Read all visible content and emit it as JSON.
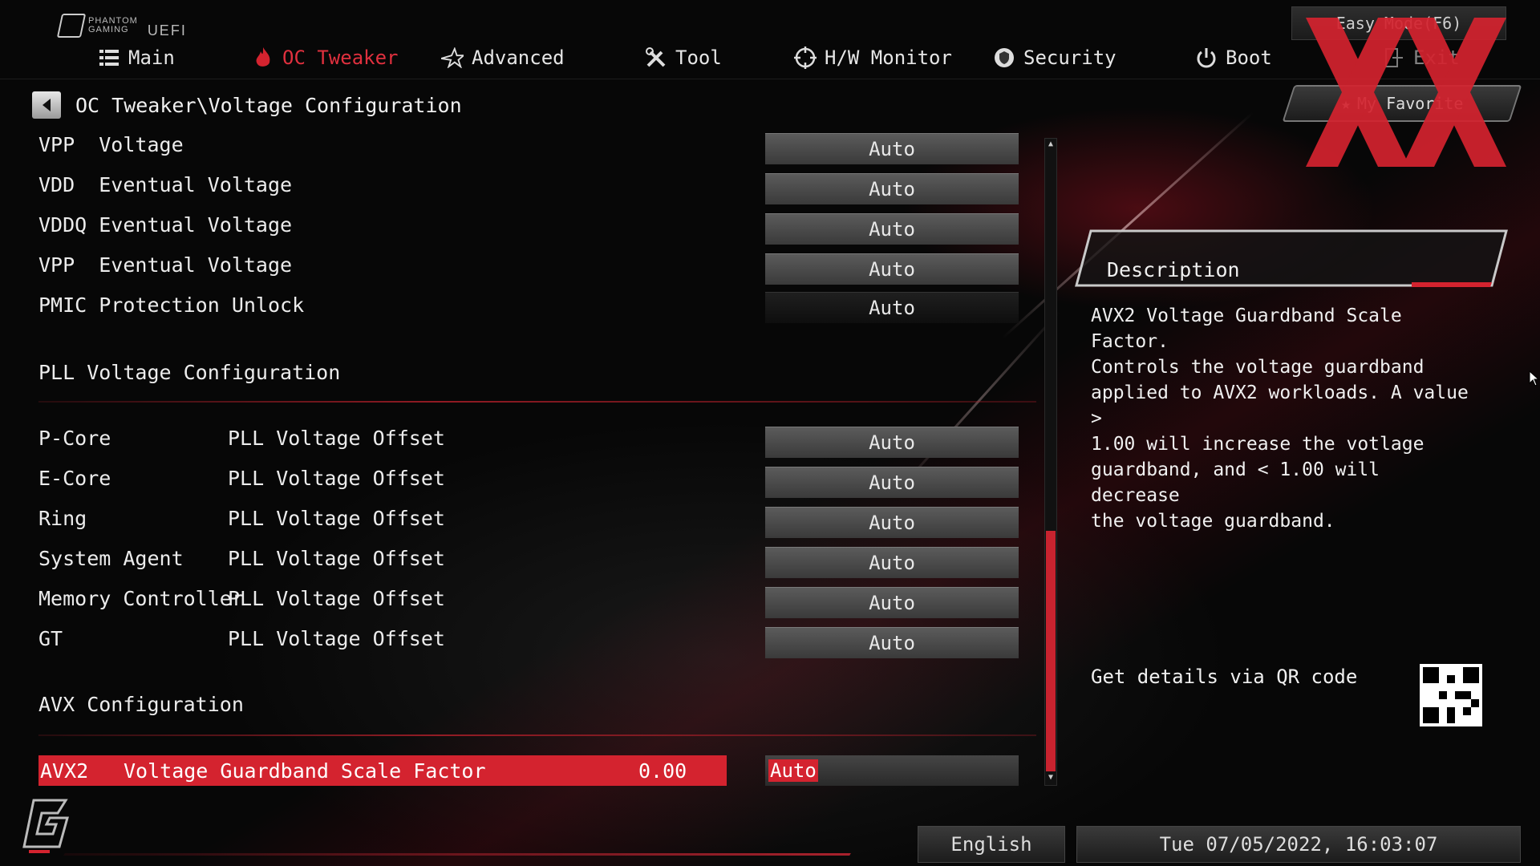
{
  "brand": {
    "line1": "PHANTOM",
    "line2": "GAMING",
    "uefi": "UEFI"
  },
  "nav": {
    "tabs": [
      {
        "label": "Main",
        "icon": "list-icon"
      },
      {
        "label": "OC Tweaker",
        "icon": "flame-icon"
      },
      {
        "label": "Advanced",
        "icon": "star-icon"
      },
      {
        "label": "Tool",
        "icon": "tools-icon"
      },
      {
        "label": "H/W Monitor",
        "icon": "monitor-icon"
      },
      {
        "label": "Security",
        "icon": "shield-icon"
      },
      {
        "label": "Boot",
        "icon": "power-icon"
      },
      {
        "label": "Exit",
        "icon": "exit-icon"
      }
    ],
    "active": "OC Tweaker",
    "easy_mode": "Easy Mode(F6)",
    "favorite": "My Favorite"
  },
  "breadcrumb": "OC Tweaker\\Voltage Configuration",
  "voltage_rows": [
    {
      "label": "VPP  Voltage",
      "value": "Auto"
    },
    {
      "label": "VDD  Eventual Voltage",
      "value": "Auto"
    },
    {
      "label": "VDDQ Eventual Voltage",
      "value": "Auto"
    },
    {
      "label": "VPP  Eventual Voltage",
      "value": "Auto"
    },
    {
      "label": "PMIC Protection Unlock",
      "value": "Auto"
    }
  ],
  "pll_section": {
    "title": "PLL Voltage Configuration",
    "rows": [
      {
        "label": "P-Core",
        "setting": "PLL Voltage Offset",
        "value": "Auto"
      },
      {
        "label": "E-Core",
        "setting": "PLL Voltage Offset",
        "value": "Auto"
      },
      {
        "label": "Ring",
        "setting": "PLL Voltage Offset",
        "value": "Auto"
      },
      {
        "label": "System Agent",
        "setting": "PLL Voltage Offset",
        "value": "Auto"
      },
      {
        "label": "Memory Controller",
        "setting": "PLL Voltage Offset",
        "value": "Auto"
      },
      {
        "label": "GT",
        "setting": "PLL Voltage Offset",
        "value": "Auto"
      }
    ]
  },
  "avx_section": {
    "title": "AVX Configuration",
    "selected_row": {
      "col1": "AVX2",
      "col2": "Voltage Guardband Scale Factor",
      "current": "0.00",
      "value": "Auto"
    }
  },
  "description": {
    "title": "Description",
    "text": "AVX2 Voltage Guardband Scale Factor.\nControls the voltage guardband\napplied to AVX2 workloads. A value >\n1.00 will increase the votlage\nguardband, and < 1.00 will decrease\nthe voltage guardband.",
    "qr_text": "Get details via QR code"
  },
  "footer": {
    "language": "English",
    "datetime": "Tue 07/05/2022, 16:03:07"
  },
  "colors": {
    "accent": "#d4232f",
    "bg": "#070707",
    "text": "#ececec"
  }
}
